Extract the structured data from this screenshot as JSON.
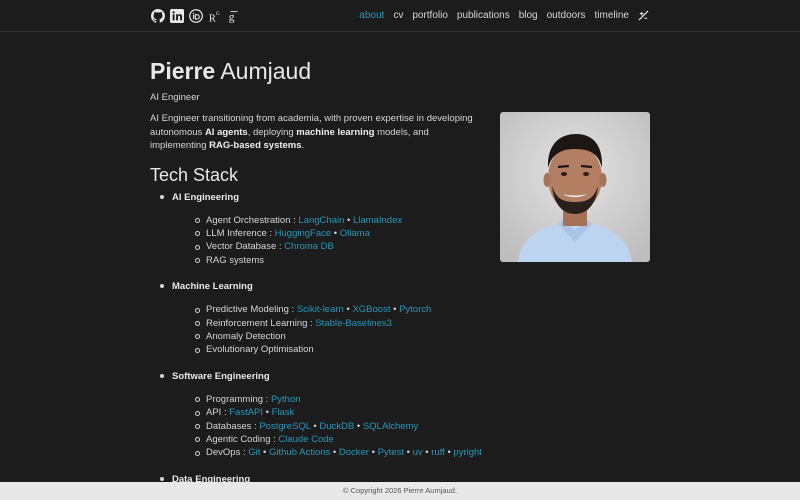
{
  "nav": {
    "icons": [
      "github-icon",
      "linkedin-icon",
      "orcid-icon",
      "researchgate-icon",
      "google-scholar-icon"
    ],
    "links": [
      {
        "label": "about",
        "active": true
      },
      {
        "label": "cv",
        "active": false
      },
      {
        "label": "portfolio",
        "active": false
      },
      {
        "label": "publications",
        "active": false
      },
      {
        "label": "blog",
        "active": false
      },
      {
        "label": "outdoors",
        "active": false
      },
      {
        "label": "timeline",
        "active": false
      }
    ]
  },
  "profile": {
    "first_name": "Pierre",
    "last_name": "Aumjaud",
    "subtitle": "AI Engineer",
    "intro_1": "AI Engineer transitioning from academia, with proven expertise in developing autonomous ",
    "intro_b1": "AI agents",
    "intro_2": ", deploying ",
    "intro_b2": "machine learning",
    "intro_3": " models, and implementing ",
    "intro_b3": "RAG-based systems",
    "intro_4": "."
  },
  "tech_stack": {
    "title": "Tech Stack",
    "categories": [
      {
        "name": "AI Engineering",
        "items": [
          {
            "label": "Agent Orchestration : ",
            "tools": [
              "LangChain",
              "LlamaIndex"
            ]
          },
          {
            "label": "LLM Inference : ",
            "tools": [
              "HuggingFace",
              "Ollama"
            ]
          },
          {
            "label": "Vector Database : ",
            "tools": [
              "Chroma DB"
            ]
          },
          {
            "label": "RAG systems",
            "tools": []
          }
        ]
      },
      {
        "name": "Machine Learning",
        "items": [
          {
            "label": "Predictive Modeling : ",
            "tools": [
              "Scikit-learn",
              "XGBoost",
              "Pytorch"
            ]
          },
          {
            "label": "Reinforcement Learning : ",
            "tools": [
              "Stable-Baselines3"
            ]
          },
          {
            "label": "Anomaly Detection",
            "tools": []
          },
          {
            "label": "Evolutionary Optimisation",
            "tools": []
          }
        ]
      },
      {
        "name": "Software Engineering",
        "items": [
          {
            "label": "Programming : ",
            "tools": [
              "Python"
            ]
          },
          {
            "label": "API : ",
            "tools": [
              "FastAPI",
              "Flask"
            ]
          },
          {
            "label": "Databases : ",
            "tools": [
              "PostgreSQL",
              "DuckDB",
              "SQLAlchemy"
            ]
          },
          {
            "label": "Agentic Coding : ",
            "tools": [
              "Claude Code"
            ]
          },
          {
            "label": "DevOps : ",
            "tools": [
              "Git",
              "Github Actions",
              "Docker",
              "Pytest",
              "uv",
              "ruff",
              "pyright"
            ]
          }
        ]
      },
      {
        "name": "Data Engineering",
        "items": []
      }
    ]
  },
  "footer": {
    "text": "© Copyright 2026 Pierre Aumjaud."
  },
  "colors": {
    "background": "#1c1c1d",
    "accent": "#2698ba",
    "text": "#d6d6d6",
    "footer_bg": "#e8e8e8"
  }
}
